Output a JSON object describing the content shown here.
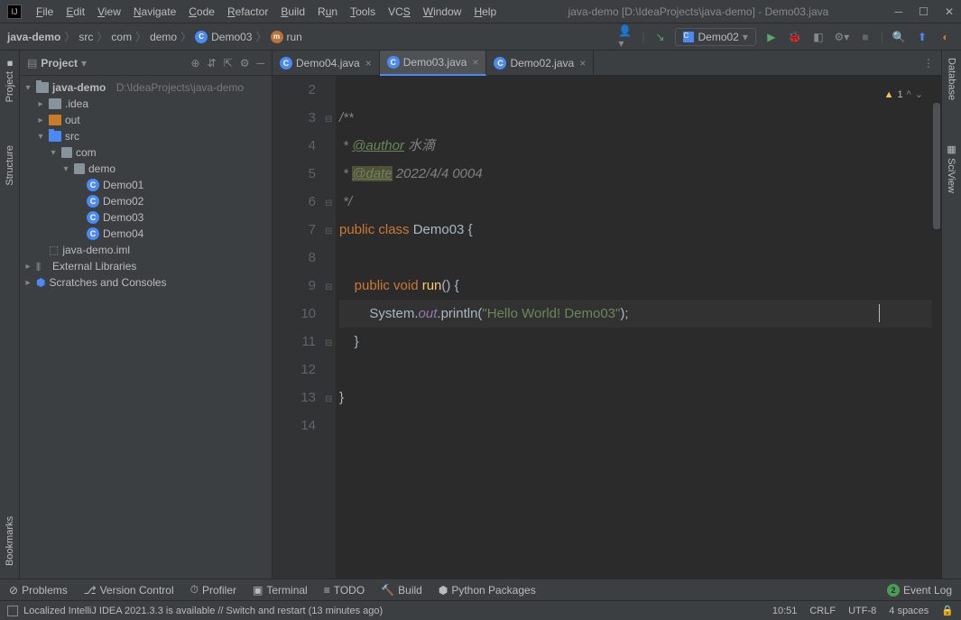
{
  "window": {
    "title": "java-demo [D:\\IdeaProjects\\java-demo] - Demo03.java"
  },
  "menu": {
    "file": "File",
    "edit": "Edit",
    "view": "View",
    "navigate": "Navigate",
    "code": "Code",
    "refactor": "Refactor",
    "build": "Build",
    "run": "Run",
    "tools": "Tools",
    "vcs": "VCS",
    "window": "Window",
    "help": "Help"
  },
  "breadcrumb": {
    "root": "java-demo",
    "src": "src",
    "com": "com",
    "demo": "demo",
    "cls": "Demo03",
    "method": "run"
  },
  "runConfig": {
    "name": "Demo02"
  },
  "sidebar": {
    "title": "Project",
    "project": {
      "name": "java-demo",
      "path": "D:\\IdeaProjects\\java-demo"
    },
    "idea": ".idea",
    "out": "out",
    "src": "src",
    "com": "com",
    "demo": "demo",
    "classes": [
      "Demo01",
      "Demo02",
      "Demo03",
      "Demo04"
    ],
    "iml": "java-demo.iml",
    "extLib": "External Libraries",
    "scratches": "Scratches and Consoles"
  },
  "tabs": [
    {
      "name": "Demo04.java",
      "active": false
    },
    {
      "name": "Demo03.java",
      "active": true
    },
    {
      "name": "Demo02.java",
      "active": false
    }
  ],
  "editor": {
    "warnings": "1",
    "lines": {
      "l2_num": "2",
      "l3_num": "3",
      "l4_num": "4",
      "l5_num": "5",
      "l6_num": "6",
      "l7_num": "7",
      "l8_num": "8",
      "l9_num": "9",
      "l10_num": "10",
      "l11_num": "11",
      "l12_num": "12",
      "l13_num": "13",
      "l14_num": "14"
    },
    "doc": {
      "open": "/**",
      "author_tag": "@author",
      "author_val": " 水滴",
      "date_tag": "@date",
      "date_val": " 2022/4/4 0004",
      "close": " */"
    },
    "class_decl": {
      "kw1": "public ",
      "kw2": "class ",
      "name": "Demo03 ",
      "brace": "{"
    },
    "method_decl": {
      "kw1": "public ",
      "kw2": "void ",
      "name": "run",
      "paren": "() {",
      "brace": ""
    },
    "stmt": {
      "sys": "System.",
      "out": "out",
      "dot": ".",
      "println": "println",
      "open": "(",
      "str": "\"Hello World! Demo03\"",
      "close": ");"
    },
    "close_method": "    }",
    "close_class": "}"
  },
  "leftTools": {
    "project": "Project",
    "structure": "Structure",
    "bookmarks": "Bookmarks"
  },
  "rightTools": {
    "database": "Database",
    "sciview": "SciView"
  },
  "bottomTools": {
    "problems": "Problems",
    "vcs": "Version Control",
    "profiler": "Profiler",
    "terminal": "Terminal",
    "todo": "TODO",
    "build": "Build",
    "python": "Python Packages",
    "eventlog": "Event Log",
    "evcount": "2"
  },
  "status": {
    "msg": "Localized IntelliJ IDEA 2021.3.3 is available // Switch and restart (13 minutes ago)",
    "time": "10:51",
    "crlf": "CRLF",
    "enc": "UTF-8",
    "spaces": "4 spaces"
  }
}
